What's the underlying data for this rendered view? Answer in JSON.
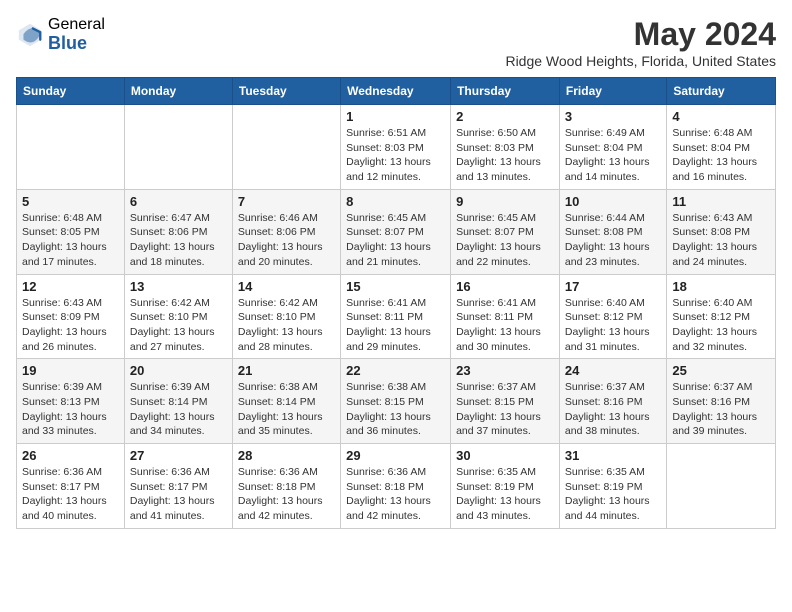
{
  "header": {
    "logo_general": "General",
    "logo_blue": "Blue",
    "title": "May 2024",
    "location": "Ridge Wood Heights, Florida, United States"
  },
  "weekdays": [
    "Sunday",
    "Monday",
    "Tuesday",
    "Wednesday",
    "Thursday",
    "Friday",
    "Saturday"
  ],
  "weeks": [
    [
      {
        "day": "",
        "info": ""
      },
      {
        "day": "",
        "info": ""
      },
      {
        "day": "",
        "info": ""
      },
      {
        "day": "1",
        "info": "Sunrise: 6:51 AM\nSunset: 8:03 PM\nDaylight: 13 hours and 12 minutes."
      },
      {
        "day": "2",
        "info": "Sunrise: 6:50 AM\nSunset: 8:03 PM\nDaylight: 13 hours and 13 minutes."
      },
      {
        "day": "3",
        "info": "Sunrise: 6:49 AM\nSunset: 8:04 PM\nDaylight: 13 hours and 14 minutes."
      },
      {
        "day": "4",
        "info": "Sunrise: 6:48 AM\nSunset: 8:04 PM\nDaylight: 13 hours and 16 minutes."
      }
    ],
    [
      {
        "day": "5",
        "info": "Sunrise: 6:48 AM\nSunset: 8:05 PM\nDaylight: 13 hours and 17 minutes."
      },
      {
        "day": "6",
        "info": "Sunrise: 6:47 AM\nSunset: 8:06 PM\nDaylight: 13 hours and 18 minutes."
      },
      {
        "day": "7",
        "info": "Sunrise: 6:46 AM\nSunset: 8:06 PM\nDaylight: 13 hours and 20 minutes."
      },
      {
        "day": "8",
        "info": "Sunrise: 6:45 AM\nSunset: 8:07 PM\nDaylight: 13 hours and 21 minutes."
      },
      {
        "day": "9",
        "info": "Sunrise: 6:45 AM\nSunset: 8:07 PM\nDaylight: 13 hours and 22 minutes."
      },
      {
        "day": "10",
        "info": "Sunrise: 6:44 AM\nSunset: 8:08 PM\nDaylight: 13 hours and 23 minutes."
      },
      {
        "day": "11",
        "info": "Sunrise: 6:43 AM\nSunset: 8:08 PM\nDaylight: 13 hours and 24 minutes."
      }
    ],
    [
      {
        "day": "12",
        "info": "Sunrise: 6:43 AM\nSunset: 8:09 PM\nDaylight: 13 hours and 26 minutes."
      },
      {
        "day": "13",
        "info": "Sunrise: 6:42 AM\nSunset: 8:10 PM\nDaylight: 13 hours and 27 minutes."
      },
      {
        "day": "14",
        "info": "Sunrise: 6:42 AM\nSunset: 8:10 PM\nDaylight: 13 hours and 28 minutes."
      },
      {
        "day": "15",
        "info": "Sunrise: 6:41 AM\nSunset: 8:11 PM\nDaylight: 13 hours and 29 minutes."
      },
      {
        "day": "16",
        "info": "Sunrise: 6:41 AM\nSunset: 8:11 PM\nDaylight: 13 hours and 30 minutes."
      },
      {
        "day": "17",
        "info": "Sunrise: 6:40 AM\nSunset: 8:12 PM\nDaylight: 13 hours and 31 minutes."
      },
      {
        "day": "18",
        "info": "Sunrise: 6:40 AM\nSunset: 8:12 PM\nDaylight: 13 hours and 32 minutes."
      }
    ],
    [
      {
        "day": "19",
        "info": "Sunrise: 6:39 AM\nSunset: 8:13 PM\nDaylight: 13 hours and 33 minutes."
      },
      {
        "day": "20",
        "info": "Sunrise: 6:39 AM\nSunset: 8:14 PM\nDaylight: 13 hours and 34 minutes."
      },
      {
        "day": "21",
        "info": "Sunrise: 6:38 AM\nSunset: 8:14 PM\nDaylight: 13 hours and 35 minutes."
      },
      {
        "day": "22",
        "info": "Sunrise: 6:38 AM\nSunset: 8:15 PM\nDaylight: 13 hours and 36 minutes."
      },
      {
        "day": "23",
        "info": "Sunrise: 6:37 AM\nSunset: 8:15 PM\nDaylight: 13 hours and 37 minutes."
      },
      {
        "day": "24",
        "info": "Sunrise: 6:37 AM\nSunset: 8:16 PM\nDaylight: 13 hours and 38 minutes."
      },
      {
        "day": "25",
        "info": "Sunrise: 6:37 AM\nSunset: 8:16 PM\nDaylight: 13 hours and 39 minutes."
      }
    ],
    [
      {
        "day": "26",
        "info": "Sunrise: 6:36 AM\nSunset: 8:17 PM\nDaylight: 13 hours and 40 minutes."
      },
      {
        "day": "27",
        "info": "Sunrise: 6:36 AM\nSunset: 8:17 PM\nDaylight: 13 hours and 41 minutes."
      },
      {
        "day": "28",
        "info": "Sunrise: 6:36 AM\nSunset: 8:18 PM\nDaylight: 13 hours and 42 minutes."
      },
      {
        "day": "29",
        "info": "Sunrise: 6:36 AM\nSunset: 8:18 PM\nDaylight: 13 hours and 42 minutes."
      },
      {
        "day": "30",
        "info": "Sunrise: 6:35 AM\nSunset: 8:19 PM\nDaylight: 13 hours and 43 minutes."
      },
      {
        "day": "31",
        "info": "Sunrise: 6:35 AM\nSunset: 8:19 PM\nDaylight: 13 hours and 44 minutes."
      },
      {
        "day": "",
        "info": ""
      }
    ]
  ]
}
